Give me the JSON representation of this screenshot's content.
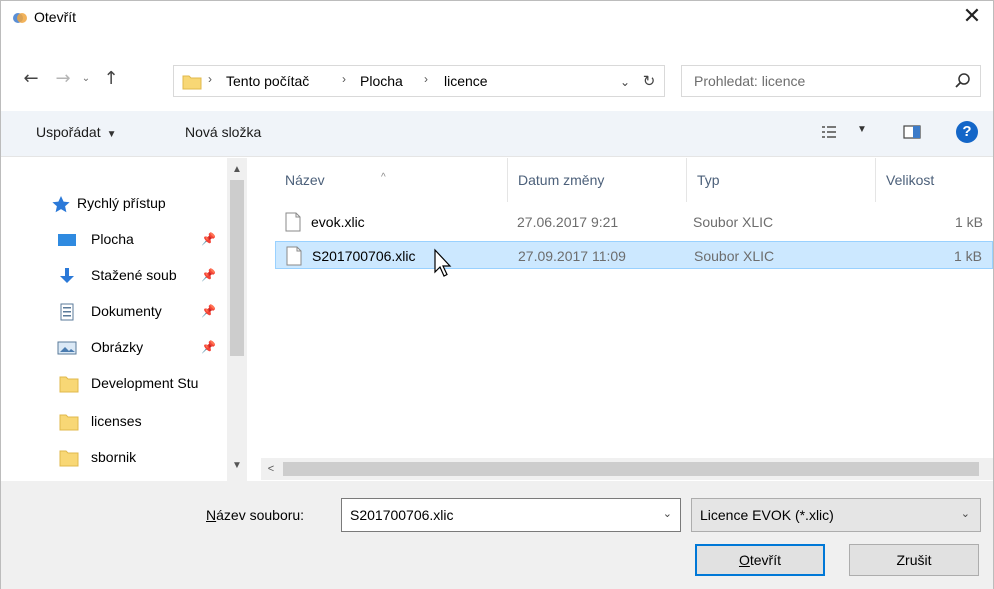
{
  "window": {
    "title": "Otevřít",
    "close_glyph": "✕"
  },
  "nav": {
    "back_glyph": "←",
    "forward_glyph": "→",
    "recent_glyph": "⌄",
    "up_glyph": "↑"
  },
  "address": {
    "breadcrumbs": [
      "Tento počítač",
      "Plocha",
      "licence"
    ],
    "separator": "›",
    "dropdown_glyph": "⌄",
    "refresh_glyph": "↻"
  },
  "search": {
    "placeholder": "Prohledat: licence",
    "icon": "search-icon"
  },
  "toolbar": {
    "organize_label": "Uspořádat",
    "organize_caret": "▼",
    "new_folder_label": "Nová složka",
    "view_caret": "▼",
    "help_label": "?"
  },
  "navpane": {
    "items": [
      {
        "label": "Rychlý přístup",
        "icon": "star-icon",
        "pinned": false
      },
      {
        "label": "Plocha",
        "icon": "desktop-icon",
        "pinned": true
      },
      {
        "label": "Stažené soub",
        "icon": "download-icon",
        "pinned": true
      },
      {
        "label": "Dokumenty",
        "icon": "documents-icon",
        "pinned": true
      },
      {
        "label": "Obrázky",
        "icon": "pictures-icon",
        "pinned": true
      },
      {
        "label": "Development Stu",
        "icon": "folder-icon",
        "pinned": false
      },
      {
        "label": "licenses",
        "icon": "folder-icon",
        "pinned": false
      },
      {
        "label": "sbornik",
        "icon": "folder-icon",
        "pinned": false
      }
    ],
    "pin_glyph": "📌"
  },
  "filelist": {
    "columns": [
      "Název",
      "Datum změny",
      "Typ",
      "Velikost"
    ],
    "rows": [
      {
        "name": "evok.xlic",
        "date": "27.06.2017 9:21",
        "type": "Soubor XLIC",
        "size": "1 kB",
        "selected": false
      },
      {
        "name": "S201700706.xlic",
        "date": "27.09.2017 11:09",
        "type": "Soubor XLIC",
        "size": "1 kB",
        "selected": true
      }
    ]
  },
  "bottom": {
    "filename_label_prefix": "N",
    "filename_label_rest": "ázev souboru:",
    "filename_value": "S201700706.xlic",
    "filter_value": "Licence EVOK (*.xlic)",
    "open_label_prefix": "O",
    "open_label_rest": "tevřít",
    "cancel_label": "Zrušit",
    "drop_glyph": "⌄"
  },
  "colors": {
    "accent": "#0078d7",
    "selection_bg": "#cce8ff",
    "selection_border": "#99d1ff",
    "folder": "#f8d775",
    "help": "#1466c8"
  }
}
